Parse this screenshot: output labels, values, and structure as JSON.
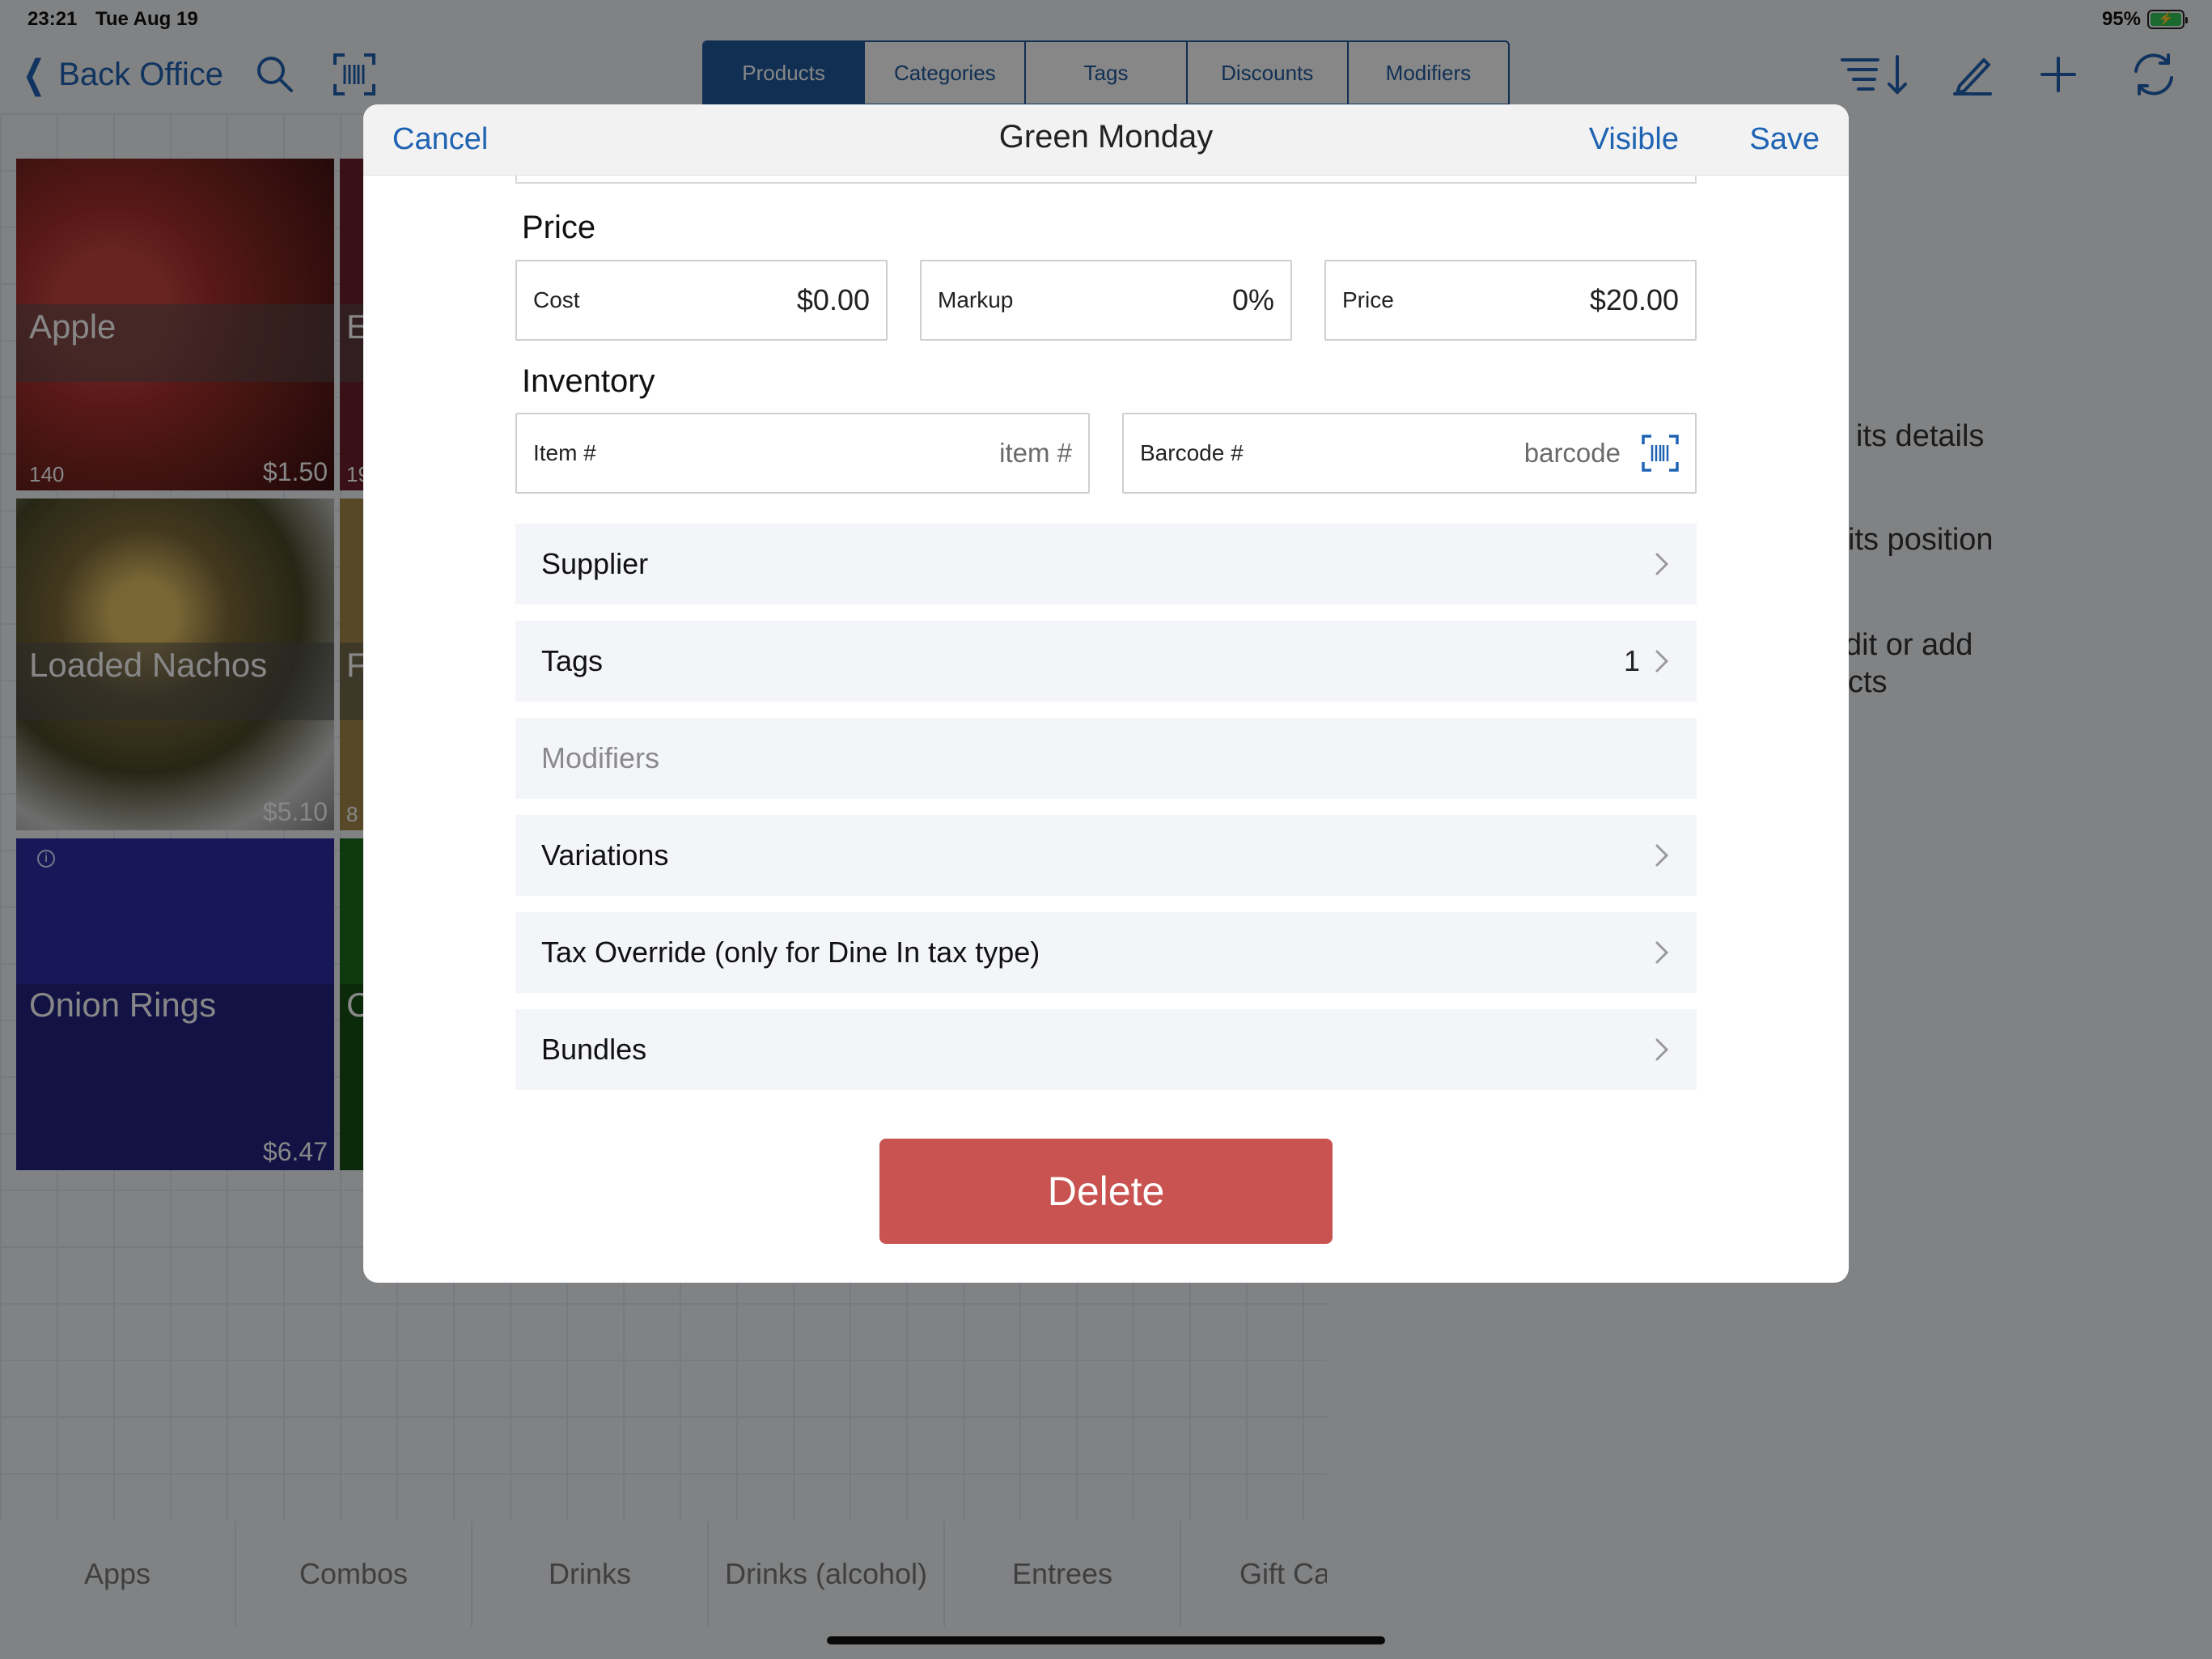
{
  "status": {
    "time": "23:21",
    "date": "Tue Aug 19",
    "battery": "95%"
  },
  "nav": {
    "back_label": "Back Office",
    "segments": [
      {
        "label": "Products",
        "active": true
      },
      {
        "label": "Categories",
        "active": false
      },
      {
        "label": "Tags",
        "active": false
      },
      {
        "label": "Discounts",
        "active": false
      },
      {
        "label": "Modifiers",
        "active": false
      }
    ]
  },
  "tiles": [
    {
      "name": "Apple",
      "count": "140",
      "price": "$1.50"
    },
    {
      "name": "Loaded Nachos",
      "price": "$5.10"
    },
    {
      "name": "Onion Rings",
      "price": "$6.47"
    }
  ],
  "partial_tiles": {
    "t1_letter": "E",
    "t1_count": "19",
    "t2_letter": "F",
    "t2_count": "8",
    "t3_letter": "C"
  },
  "hints": {
    "line1": "its details",
    "line2": "its position",
    "line3a": "dit or add",
    "line3b": "cts"
  },
  "categories": [
    "Apps",
    "Combos",
    "Drinks",
    "Drinks (alcohol)",
    "Entrees",
    "Gift Ca"
  ],
  "modal": {
    "cancel": "Cancel",
    "title": "Green Monday",
    "visible": "Visible",
    "save": "Save",
    "price_section": "Price",
    "cost_label": "Cost",
    "cost_value": "$0.00",
    "markup_label": "Markup",
    "markup_value": "0%",
    "price_label": "Price",
    "price_value": "$20.00",
    "inventory_section": "Inventory",
    "item_label": "Item #",
    "item_placeholder": "item #",
    "barcode_label": "Barcode #",
    "barcode_placeholder": "barcode",
    "rows": {
      "supplier": "Supplier",
      "tags": "Tags",
      "tags_count": "1",
      "modifiers": "Modifiers",
      "variations": "Variations",
      "tax_override": "Tax Override (only for Dine In tax type)",
      "bundles": "Bundles"
    },
    "delete": "Delete"
  },
  "colors": {
    "accent": "#1f63b3",
    "segment_active": "#1f5a9e",
    "delete": "#c85350"
  }
}
